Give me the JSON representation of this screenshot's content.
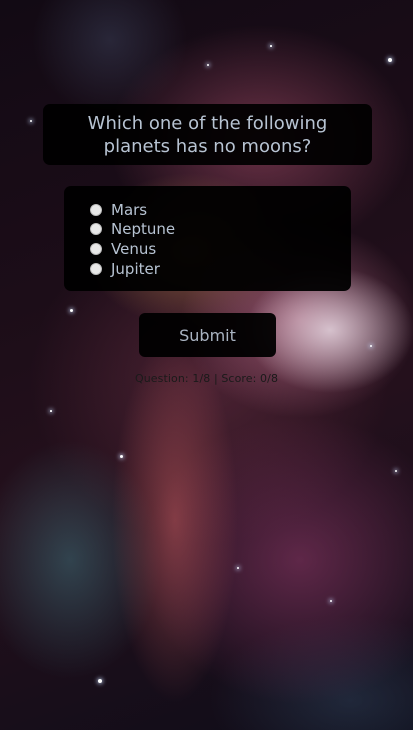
{
  "question": {
    "text": "Which one of the following planets has no moons?"
  },
  "options": [
    {
      "label": "Mars",
      "selected": false
    },
    {
      "label": "Neptune",
      "selected": false
    },
    {
      "label": "Venus",
      "selected": false
    },
    {
      "label": "Jupiter",
      "selected": false
    }
  ],
  "submit_label": "Submit",
  "status": {
    "text": "Question: 1/8 | Score: 0/8",
    "current_question": 1,
    "total_questions": 8,
    "score": 0
  },
  "background": {
    "type": "nebula-image"
  }
}
